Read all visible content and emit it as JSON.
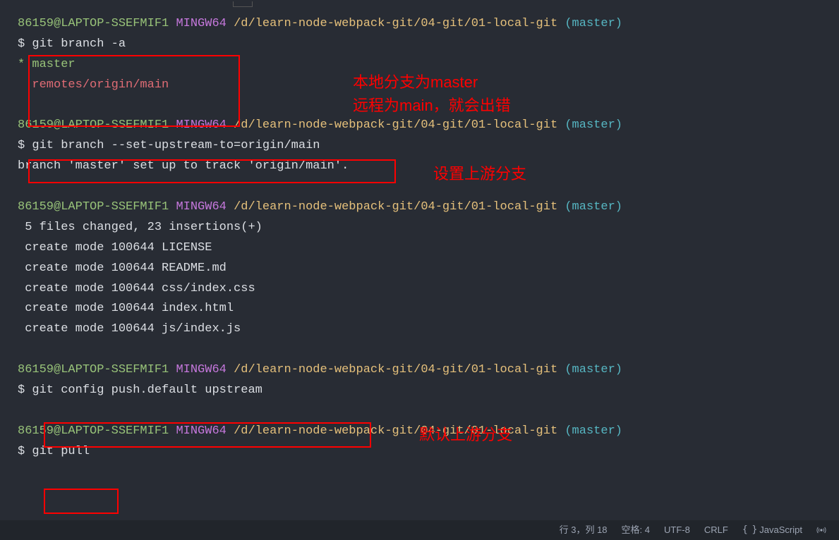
{
  "prompt": {
    "user": "86159@LAPTOP-SSEFMIF1",
    "shell": "MINGW64",
    "path": "/d/learn-node-webpack-git/04-git/01-local-git",
    "branch": "(master)"
  },
  "block1": {
    "cmd": "git branch -a",
    "out1": "* master",
    "out2": "  remotes/origin/main"
  },
  "block2": {
    "cmd": "git branch --set-upstream-to=origin/main",
    "out1": "branch 'master' set up to track 'origin/main'."
  },
  "block3": {
    "out1": " 5 files changed, 23 insertions(+)",
    "out2": " create mode 100644 LICENSE",
    "out3": " create mode 100644 README.md",
    "out4": " create mode 100644 css/index.css",
    "out5": " create mode 100644 index.html",
    "out6": " create mode 100644 js/index.js"
  },
  "block4": {
    "cmd": "git config push.default upstream"
  },
  "block5": {
    "cmd": "git pull"
  },
  "annotations": {
    "a1_line1": "本地分支为master",
    "a1_line2": "远程为main，就会出错",
    "a2": "设置上游分支",
    "a3": "默认上游分支"
  },
  "statusbar": {
    "position": "行 3，列 18",
    "spaces": "空格: 4",
    "encoding": "UTF-8",
    "eol": "CRLF",
    "lang": "JavaScript"
  }
}
